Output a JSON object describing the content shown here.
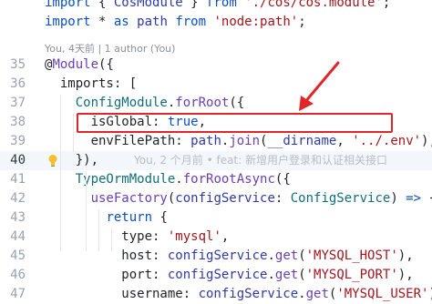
{
  "codelens": "You, 4天前 | 1 author (You)",
  "lines": [
    {
      "num": "",
      "tokens": [
        {
          "t": "import",
          "c": "kw"
        },
        {
          "t": " { ",
          "c": "prop"
        },
        {
          "t": "CosModule",
          "c": "var"
        },
        {
          "t": " } ",
          "c": "prop"
        },
        {
          "t": "from",
          "c": "kw"
        },
        {
          "t": " ",
          "c": "prop"
        },
        {
          "t": "'./cos/cos.module'",
          "c": "str"
        },
        {
          "t": ";",
          "c": "prop"
        }
      ]
    },
    {
      "num": "",
      "tokens": [
        {
          "t": "import",
          "c": "kw"
        },
        {
          "t": " * ",
          "c": "prop"
        },
        {
          "t": "as",
          "c": "kw"
        },
        {
          "t": " path ",
          "c": "var"
        },
        {
          "t": "from",
          "c": "kw"
        },
        {
          "t": " ",
          "c": "prop"
        },
        {
          "t": "'node:path'",
          "c": "str"
        },
        {
          "t": ";",
          "c": "prop"
        }
      ]
    },
    {
      "num": "35",
      "tokens": [
        {
          "t": "@",
          "c": "dec"
        },
        {
          "t": "Module",
          "c": "fn"
        },
        {
          "t": "({",
          "c": "prop"
        }
      ]
    },
    {
      "num": "36",
      "tokens": [
        {
          "t": "  imports",
          "c": "prop"
        },
        {
          "t": ": [",
          "c": "prop"
        }
      ]
    },
    {
      "num": "37",
      "tokens": [
        {
          "t": "    ConfigModule",
          "c": "type"
        },
        {
          "t": ".",
          "c": "prop"
        },
        {
          "t": "forRoot",
          "c": "fn"
        },
        {
          "t": "({",
          "c": "prop"
        }
      ]
    },
    {
      "num": "38",
      "tokens": [
        {
          "t": "      isGlobal",
          "c": "prop"
        },
        {
          "t": ": ",
          "c": "prop"
        },
        {
          "t": "true",
          "c": "lit"
        },
        {
          "t": ",",
          "c": "prop"
        }
      ]
    },
    {
      "num": "39",
      "tokens": [
        {
          "t": "      envFilePath",
          "c": "prop"
        },
        {
          "t": ": ",
          "c": "prop"
        },
        {
          "t": "path",
          "c": "var"
        },
        {
          "t": ".",
          "c": "prop"
        },
        {
          "t": "join",
          "c": "fn"
        },
        {
          "t": "(",
          "c": "prop"
        },
        {
          "t": "__dirname",
          "c": "var"
        },
        {
          "t": ", ",
          "c": "prop"
        },
        {
          "t": "'../.env'",
          "c": "str"
        },
        {
          "t": "),",
          "c": "prop"
        }
      ]
    },
    {
      "num": "40",
      "current": true,
      "tokens": [
        {
          "t": "    }),",
          "c": "prop"
        }
      ],
      "blame": "You, 2 个月前 • feat: 新增用户登录和认证相关接口"
    },
    {
      "num": "41",
      "tokens": [
        {
          "t": "    TypeOrmModule",
          "c": "type"
        },
        {
          "t": ".",
          "c": "prop"
        },
        {
          "t": "forRootAsync",
          "c": "fn"
        },
        {
          "t": "({",
          "c": "prop"
        }
      ]
    },
    {
      "num": "42",
      "tokens": [
        {
          "t": "      useFactory",
          "c": "fn"
        },
        {
          "t": "(",
          "c": "prop"
        },
        {
          "t": "configService",
          "c": "var"
        },
        {
          "t": ": ",
          "c": "prop"
        },
        {
          "t": "ConfigService",
          "c": "type"
        },
        {
          "t": ") ",
          "c": "prop"
        },
        {
          "t": "=>",
          "c": "kw"
        },
        {
          "t": " {",
          "c": "prop"
        }
      ]
    },
    {
      "num": "43",
      "tokens": [
        {
          "t": "        ",
          "c": "prop"
        },
        {
          "t": "return",
          "c": "kw"
        },
        {
          "t": " {",
          "c": "prop"
        }
      ]
    },
    {
      "num": "44",
      "tokens": [
        {
          "t": "          type",
          "c": "prop"
        },
        {
          "t": ": ",
          "c": "prop"
        },
        {
          "t": "'mysql'",
          "c": "str"
        },
        {
          "t": ",",
          "c": "prop"
        }
      ]
    },
    {
      "num": "45",
      "tokens": [
        {
          "t": "          host",
          "c": "prop"
        },
        {
          "t": ": ",
          "c": "prop"
        },
        {
          "t": "configService",
          "c": "var"
        },
        {
          "t": ".",
          "c": "prop"
        },
        {
          "t": "get",
          "c": "fn"
        },
        {
          "t": "(",
          "c": "prop"
        },
        {
          "t": "'MYSQL_HOST'",
          "c": "str"
        },
        {
          "t": "),",
          "c": "prop"
        }
      ]
    },
    {
      "num": "46",
      "tokens": [
        {
          "t": "          port",
          "c": "prop"
        },
        {
          "t": ": ",
          "c": "prop"
        },
        {
          "t": "configService",
          "c": "var"
        },
        {
          "t": ".",
          "c": "prop"
        },
        {
          "t": "get",
          "c": "fn"
        },
        {
          "t": "(",
          "c": "prop"
        },
        {
          "t": "'MYSQL_PORT'",
          "c": "str"
        },
        {
          "t": "),",
          "c": "prop"
        }
      ]
    },
    {
      "num": "47",
      "tokens": [
        {
          "t": "          username",
          "c": "prop"
        },
        {
          "t": ": ",
          "c": "prop"
        },
        {
          "t": "configService",
          "c": "var"
        },
        {
          "t": ".",
          "c": "prop"
        },
        {
          "t": "get",
          "c": "fn"
        },
        {
          "t": "(",
          "c": "prop"
        },
        {
          "t": "'MYSQL_USER'",
          "c": "str"
        },
        {
          "t": "),",
          "c": "prop"
        }
      ]
    }
  ],
  "colors": {
    "annotation": "#e0262b",
    "keyword": "#0b4fc0",
    "string": "#a3151d"
  },
  "icons": [
    "lightbulb-icon",
    "annotation-arrow"
  ]
}
